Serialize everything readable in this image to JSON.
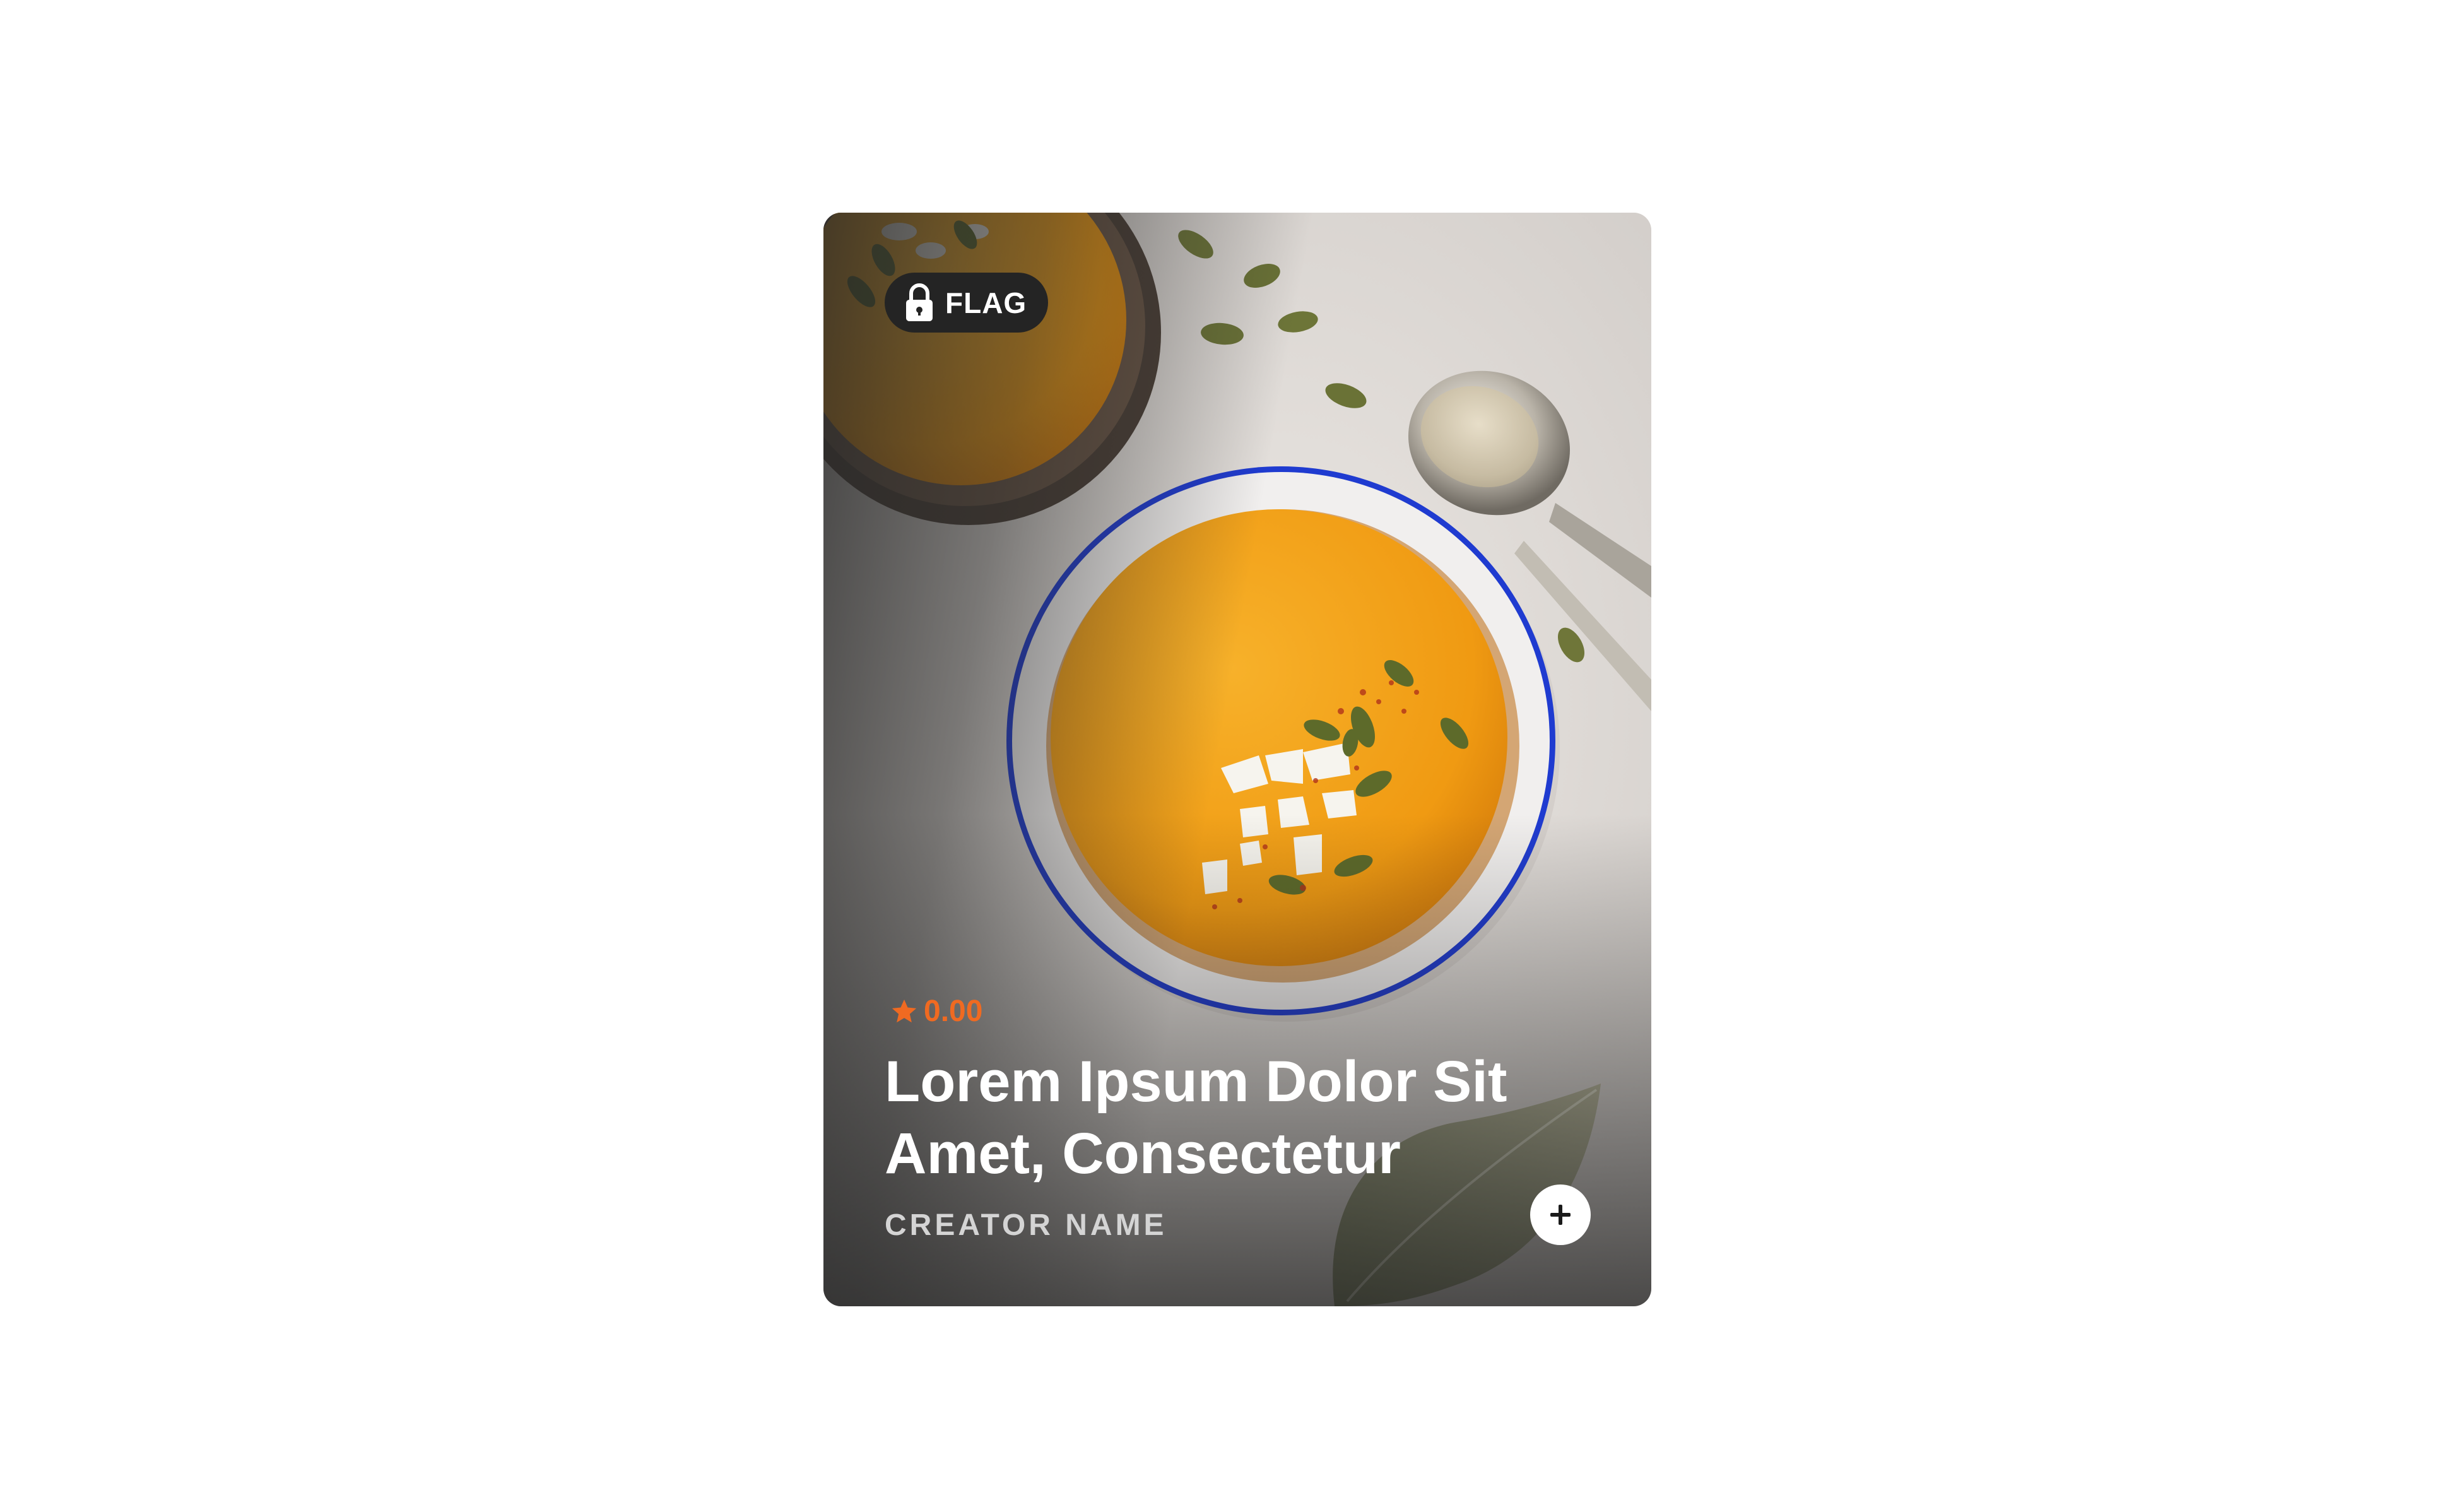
{
  "card": {
    "flag_label": "FLAG",
    "rating": "0.00",
    "title": "Lorem Ipsum Dolor Sit Amet, Consectetur",
    "creator": "CREATOR NAME"
  },
  "icons": {
    "flag": "lock-icon",
    "rating": "star-icon",
    "add": "plus-icon"
  },
  "colors": {
    "accent": "#f06a21",
    "pill_background": "#242424",
    "soup": "#f3a21d",
    "bowl_rim": "#1b34c8"
  }
}
